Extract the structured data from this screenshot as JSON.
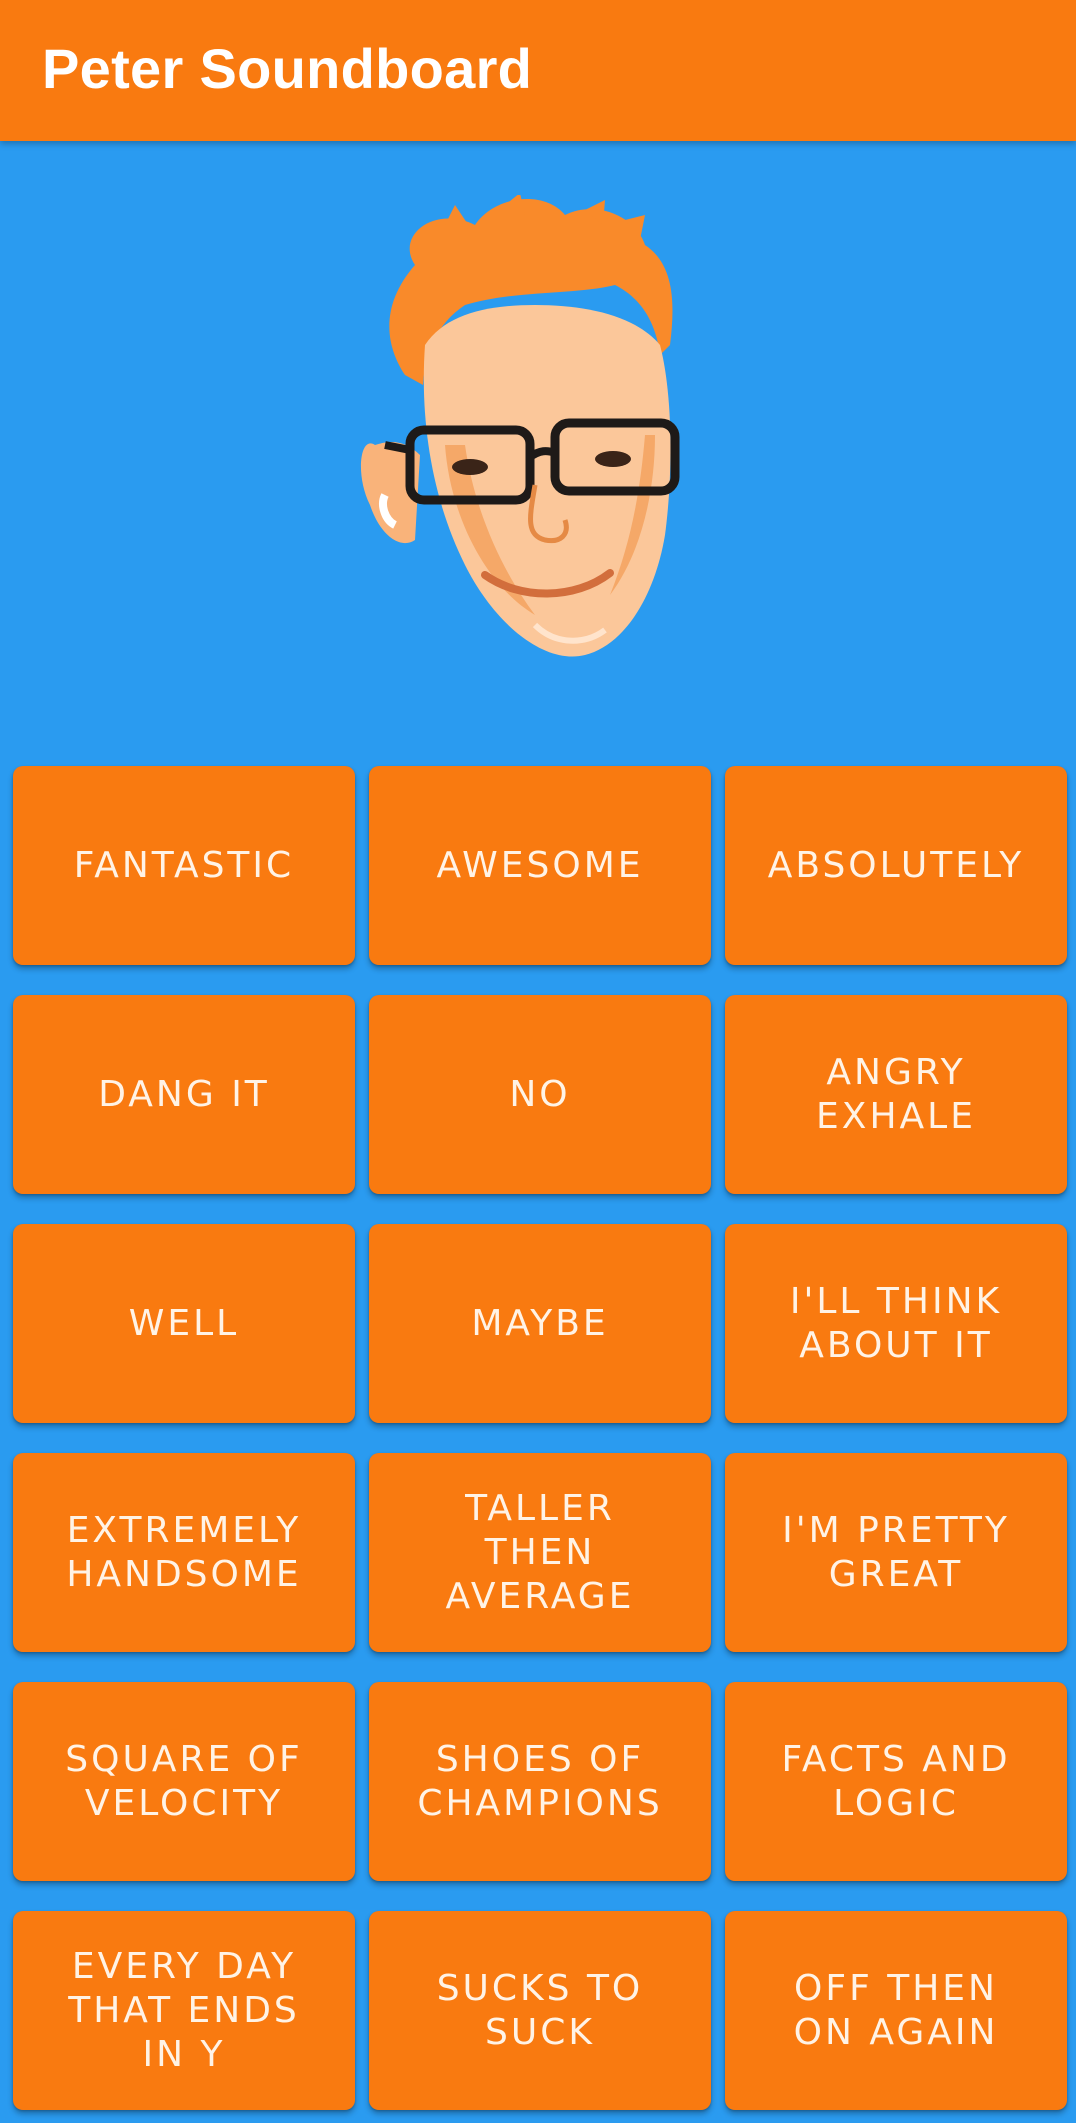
{
  "app_bar": {
    "title": "Peter Soundboard",
    "background_color": "#F97A10",
    "title_color": "#FFFFFF"
  },
  "main": {
    "background_color": "#2A9BF0",
    "avatar_icon": "peter-face-illustration"
  },
  "buttons": {
    "color": "#F97A10",
    "items": [
      {
        "label": "FANTASTIC"
      },
      {
        "label": "AWESOME"
      },
      {
        "label": "ABSOLUTELY"
      },
      {
        "label": "DANG IT"
      },
      {
        "label": "NO"
      },
      {
        "label": "ANGRY\nEXHALE"
      },
      {
        "label": "WELL"
      },
      {
        "label": "MAYBE"
      },
      {
        "label": "I'LL THINK\nABOUT IT"
      },
      {
        "label": "EXTREMELY\nHANDSOME"
      },
      {
        "label": "TALLER\nTHEN\nAVERAGE"
      },
      {
        "label": "I'M PRETTY\nGREAT"
      },
      {
        "label": "SQUARE OF\nVELOCITY"
      },
      {
        "label": "SHOES OF\nCHAMPIONS"
      },
      {
        "label": "FACTS AND\nLOGIC"
      },
      {
        "label": "EVERY DAY\nTHAT ENDS\nIN Y"
      },
      {
        "label": "SUCKS TO\nSUCK"
      },
      {
        "label": "OFF THEN\nON AGAIN"
      }
    ]
  }
}
